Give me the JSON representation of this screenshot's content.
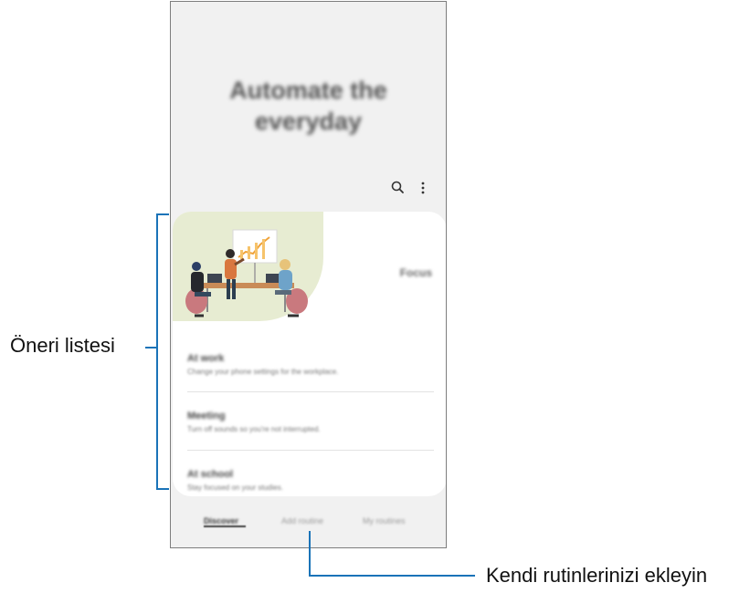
{
  "hero": {
    "line1": "Automate the",
    "line2": "everyday"
  },
  "toolbar": {
    "search_icon": "search-icon",
    "more_icon": "more-vert-icon"
  },
  "card": {
    "focus_label": "Focus",
    "items": [
      {
        "title": "At work",
        "subtitle": "Change your phone settings for the workplace."
      },
      {
        "title": "Meeting",
        "subtitle": "Turn off sounds so you're not interrupted."
      },
      {
        "title": "At school",
        "subtitle": "Stay focused on your studies."
      }
    ]
  },
  "tabs": [
    {
      "label": "Discover"
    },
    {
      "label": "Add routine"
    },
    {
      "label": "My routines"
    }
  ],
  "annotations": {
    "suggestions_label": "Öneri listesi",
    "add_label": "Kendi rutinlerinizi ekleyin"
  },
  "colors": {
    "accent": "#1a73b8",
    "illustration_blob": "#e7ecd2"
  }
}
